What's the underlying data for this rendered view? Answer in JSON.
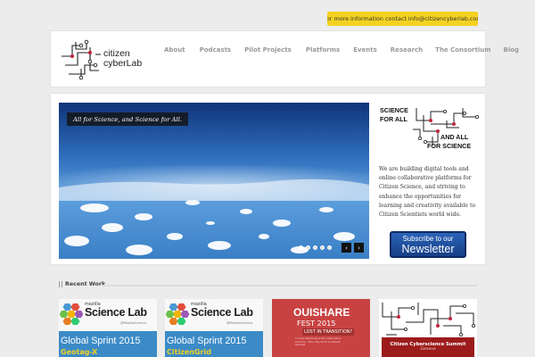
{
  "topbar": {
    "info_text": "For more information contact info@citizencyberlab.com"
  },
  "header": {
    "logo_text_line1": "citizen",
    "logo_text_line2": "cyberLab",
    "nav": [
      "About",
      "Podcasts",
      "Pilot Projects",
      "Platforms",
      "Events",
      "Research",
      "The Consortium",
      "Blog"
    ]
  },
  "hero": {
    "caption": "All for Science, and Science for All.",
    "slide_count": 5,
    "active_slide": 1,
    "prev_label": "‹",
    "next_label": "›"
  },
  "sidebar": {
    "title_line1": "SCIENCE",
    "title_line2": "FOR ALL",
    "title_line3": "AND ALL",
    "title_line4": "FOR SCIENCE",
    "description": "We are building digital tools and online collaborative platforms for Citizen Science, and striving to enhance the opportunities for learning and creativity available to Citizen Scientists world wide.",
    "newsletter_line1": "Subscribe to our",
    "newsletter_line2": "Newsletter"
  },
  "recent": {
    "label": "Recent Work",
    "items": [
      {
        "mozilla": "mozilla",
        "title": "Science Lab",
        "handle": "@MozillaScience",
        "sprint": "Global Sprint 2015",
        "sub": "Geotag-X"
      },
      {
        "mozilla": "mozilla",
        "title": "Science Lab",
        "handle": "@MozillaScience",
        "sprint": "Global Sprint 2015",
        "sub": "CitizenGrid"
      },
      {
        "title": "OUISHARE",
        "fest": "FEST 2015",
        "lost": "LOST IN TRANSITION?",
        "small": "A 3-day festival about the collaborative economy · Paris, May 20-22 at Cabaret Sauvage"
      },
      {
        "title": "Citizen Cyberscience Summit",
        "sub": "Geneva"
      }
    ]
  },
  "colors": {
    "accent_yellow": "#f4d221",
    "newsletter_blue": "#2b63b8",
    "sky_blue": "#3d82c4",
    "ouishare_red": "#c94242"
  }
}
